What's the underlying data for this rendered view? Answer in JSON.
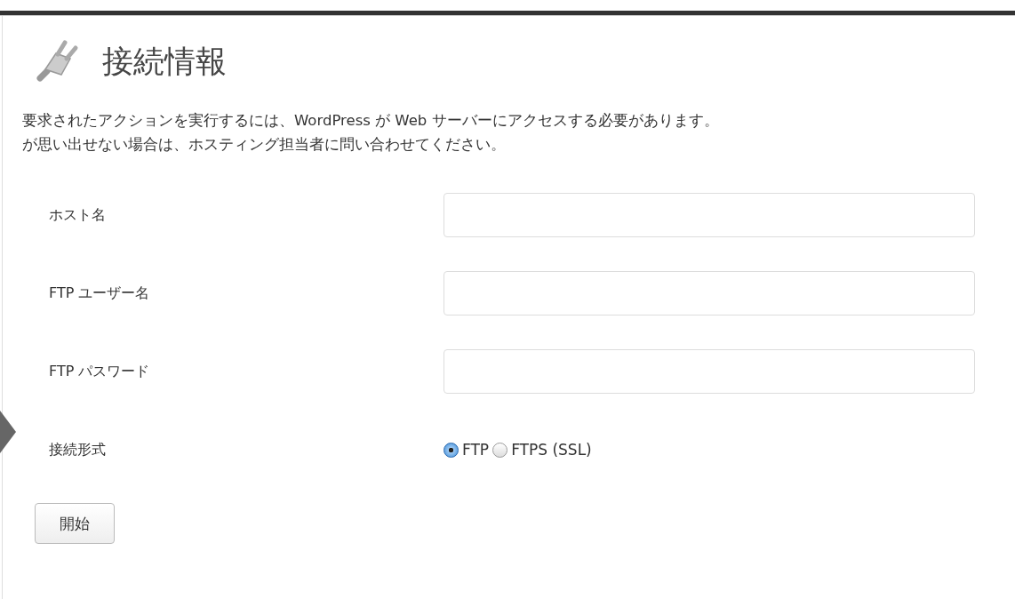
{
  "heading": "接続情報",
  "description": [
    "要求されたアクションを実行するには、WordPress が Web サーバーにアクセスする必要があります。",
    "が思い出せない場合は、ホスティング担当者に問い合わせてください。"
  ],
  "fields": [
    {
      "kind": "text",
      "label": "ホスト名"
    },
    {
      "kind": "text",
      "label": "FTP ユーザー名"
    },
    {
      "kind": "password",
      "label": "FTP パスワード"
    },
    {
      "kind": "radio",
      "label": "接続形式",
      "options": [
        {
          "label": "FTP",
          "selected": true
        },
        {
          "label": "FTPS (SSL)",
          "selected": false
        }
      ]
    }
  ],
  "submit": "開始"
}
